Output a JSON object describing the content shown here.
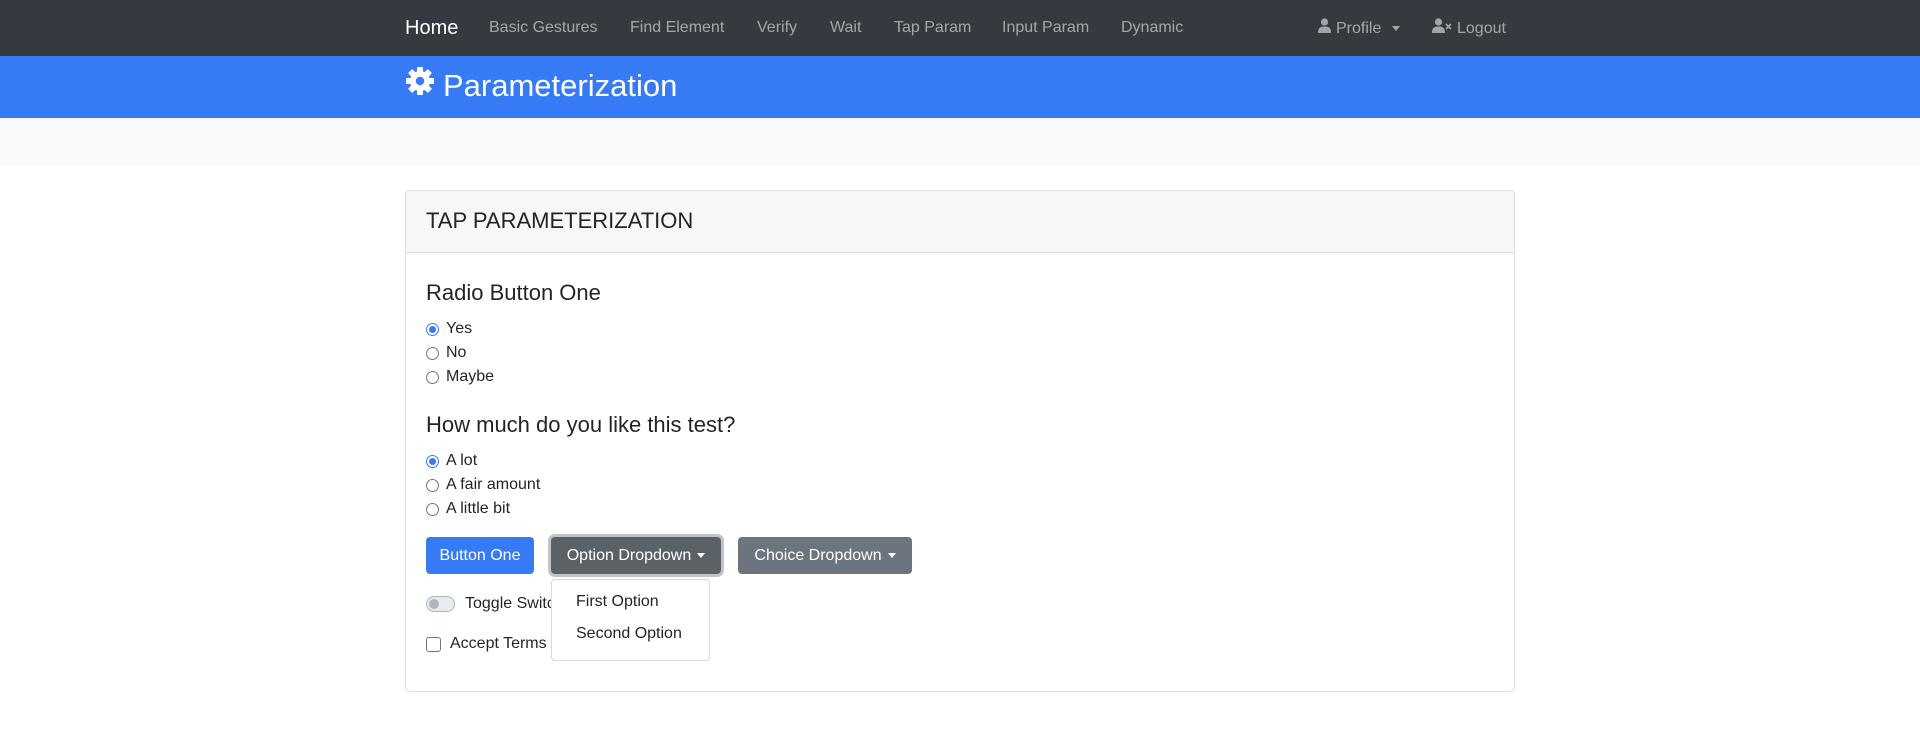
{
  "navbar": {
    "brand": "Home",
    "links": [
      "Basic Gestures",
      "Find Element",
      "Verify",
      "Wait",
      "Tap Param",
      "Input Param",
      "Dynamic"
    ],
    "profile_label": "Profile",
    "logout_label": "Logout"
  },
  "banner": {
    "title": "Parameterization"
  },
  "card": {
    "title": "TAP PARAMETERIZATION",
    "radio_group_one": {
      "title": "Radio Button One",
      "options": [
        "Yes",
        "No",
        "Maybe"
      ],
      "selected": "Yes"
    },
    "radio_group_two": {
      "title": "How much do you like this test?",
      "options": [
        "A lot",
        "A fair amount",
        "A little bit"
      ],
      "selected": "A lot"
    },
    "button_one_label": "Button One",
    "option_dropdown_label": "Option Dropdown",
    "choice_dropdown_label": "Choice Dropdown",
    "option_dropdown_items": [
      "First Option",
      "Second Option"
    ],
    "toggle_label": "Toggle Switch",
    "accept_terms_label": "Accept Terms"
  },
  "colors": {
    "navbar": "#343a40",
    "banner": "#367bf5",
    "primary": "#367bf5",
    "secondary": "#6c757d"
  },
  "icons": {
    "banner": "gear-icon",
    "profile": "user-icon",
    "logout": "user-times-icon"
  }
}
